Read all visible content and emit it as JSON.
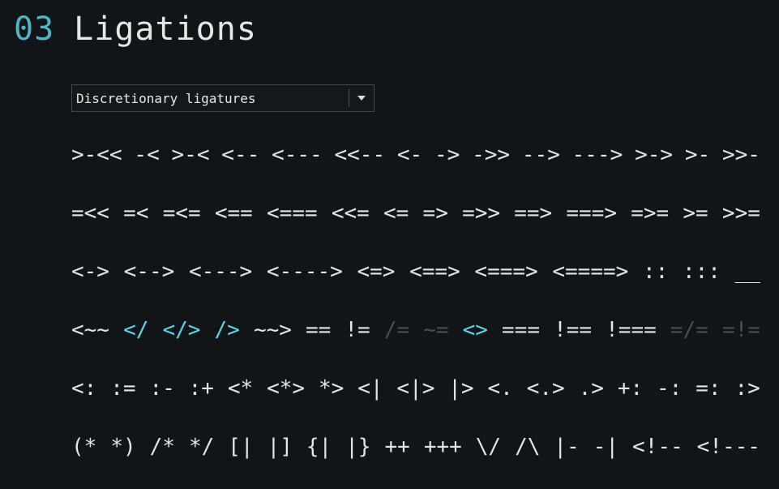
{
  "section": {
    "number": "03",
    "title": "Ligations"
  },
  "dropdown": {
    "value": "Discretionary ligatures",
    "icon": "caret-down-icon"
  },
  "colors": {
    "background": "#111517",
    "text": "#e3e6e6",
    "accent": "#57d8ec",
    "muted": "#4a4f52"
  },
  "rows": [
    [
      {
        "t": ">-<<"
      },
      {
        "t": "-<"
      },
      {
        "t": ">-<"
      },
      {
        "t": "<--"
      },
      {
        "t": "<---"
      },
      {
        "t": "<<--"
      },
      {
        "t": "<-"
      },
      {
        "t": "->"
      },
      {
        "t": "->>"
      },
      {
        "t": "-->"
      },
      {
        "t": "--->"
      },
      {
        "t": ">->"
      },
      {
        "t": ">-"
      },
      {
        "t": ">>-"
      }
    ],
    [
      {
        "t": "=<<"
      },
      {
        "t": "=<"
      },
      {
        "t": "=<="
      },
      {
        "t": "<=="
      },
      {
        "t": "<==="
      },
      {
        "t": "<<="
      },
      {
        "t": "<="
      },
      {
        "t": "=>"
      },
      {
        "t": "=>>"
      },
      {
        "t": "==>"
      },
      {
        "t": "===>"
      },
      {
        "t": "=>="
      },
      {
        "t": ">="
      },
      {
        "t": ">>="
      }
    ],
    [
      {
        "t": "<->"
      },
      {
        "t": "<-->"
      },
      {
        "t": "<--->"
      },
      {
        "t": "<---->"
      },
      {
        "t": "<=>"
      },
      {
        "t": "<==>"
      },
      {
        "t": "<===>"
      },
      {
        "t": "<====>"
      },
      {
        "t": "::"
      },
      {
        "t": ":::"
      },
      {
        "t": "__"
      }
    ],
    [
      {
        "t": "<~~"
      },
      {
        "t": "</",
        "s": "accent"
      },
      {
        "t": "</>",
        "s": "accent"
      },
      {
        "t": "/>",
        "s": "accent"
      },
      {
        "t": "~~>"
      },
      {
        "t": "=="
      },
      {
        "t": "!="
      },
      {
        "t": "/=",
        "s": "muted"
      },
      {
        "t": "~=",
        "s": "muted"
      },
      {
        "t": "<>",
        "s": "accent"
      },
      {
        "t": "==="
      },
      {
        "t": "!=="
      },
      {
        "t": "!==="
      },
      {
        "t": "=/=",
        "s": "muted"
      },
      {
        "t": "=!=",
        "s": "muted"
      }
    ],
    [
      {
        "t": "<:"
      },
      {
        "t": ":="
      },
      {
        "t": ":-"
      },
      {
        "t": ":+"
      },
      {
        "t": "<*"
      },
      {
        "t": "<*>"
      },
      {
        "t": "*>"
      },
      {
        "t": "<|"
      },
      {
        "t": "<|>"
      },
      {
        "t": "|>"
      },
      {
        "t": "<."
      },
      {
        "t": "<.>"
      },
      {
        "t": ".>"
      },
      {
        "t": "+:"
      },
      {
        "t": "-:"
      },
      {
        "t": "=:"
      },
      {
        "t": ":>"
      }
    ],
    [
      {
        "t": "(*"
      },
      {
        "t": "*)"
      },
      {
        "t": "/*"
      },
      {
        "t": "*/"
      },
      {
        "t": "[|"
      },
      {
        "t": "|]"
      },
      {
        "t": "{|"
      },
      {
        "t": "|}"
      },
      {
        "t": "++"
      },
      {
        "t": "+++"
      },
      {
        "t": "\\/"
      },
      {
        "t": "/\\"
      },
      {
        "t": "|-"
      },
      {
        "t": "-|"
      },
      {
        "t": "<!--"
      },
      {
        "t": "<!---"
      }
    ]
  ]
}
